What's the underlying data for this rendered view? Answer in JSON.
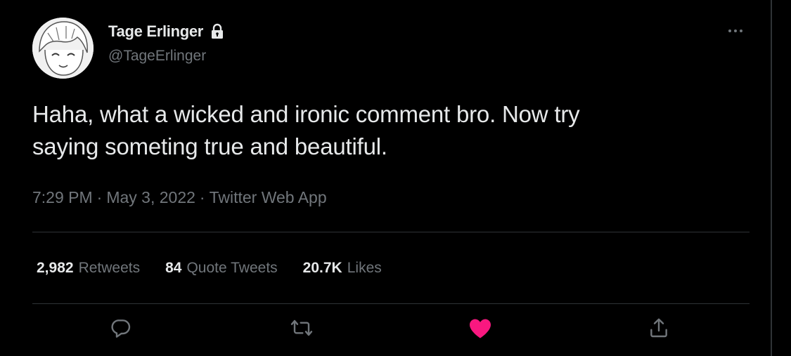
{
  "tweet": {
    "author": {
      "display_name": "Tage Erlinger",
      "handle": "@TageErlinger",
      "protected_icon": "lock-icon"
    },
    "text_line1": "Haha, what a wicked and ironic comment bro. Now try",
    "text_line2": "saying someting true and beautiful.",
    "time": "7:29 PM",
    "date": "May 3, 2022",
    "source": "Twitter Web App",
    "separator": "·",
    "stats": {
      "retweets_count": "2,982",
      "retweets_label": "Retweets",
      "quote_tweets_count": "84",
      "quote_tweets_label": "Quote Tweets",
      "likes_count": "20.7K",
      "likes_label": "Likes"
    },
    "actions": [
      {
        "name": "reply",
        "icon": "reply-icon"
      },
      {
        "name": "retweet",
        "icon": "retweet-icon"
      },
      {
        "name": "like",
        "icon": "heart-icon",
        "active": true
      },
      {
        "name": "share",
        "icon": "share-icon"
      }
    ]
  },
  "colors": {
    "background": "#000000",
    "primary_text": "#e7e9ea",
    "secondary_text": "#71767b",
    "divider": "#2f3336",
    "like_active": "#f91880"
  }
}
